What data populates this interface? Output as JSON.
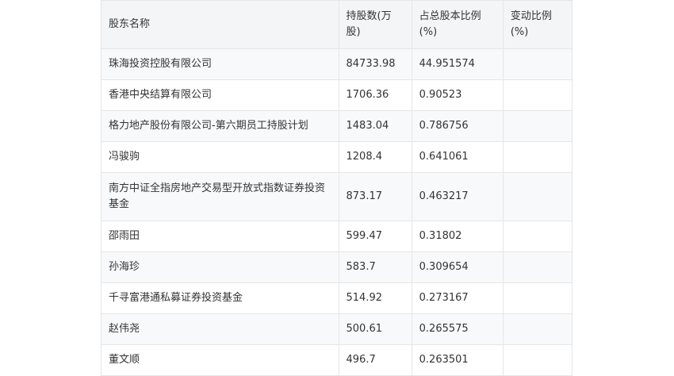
{
  "table": {
    "headers": [
      "股东名称",
      "持股数(万股)",
      "占总股本比例(%)",
      "变动比例(%)"
    ],
    "rows": [
      {
        "name": "珠海投资控股有限公司",
        "shares": "84733.98",
        "ratio": "44.951574",
        "change": ""
      },
      {
        "name": "香港中央结算有限公司",
        "shares": "1706.36",
        "ratio": "0.90523",
        "change": ""
      },
      {
        "name": "格力地产股份有限公司-第六期员工持股计划",
        "shares": "1483.04",
        "ratio": "0.786756",
        "change": ""
      },
      {
        "name": "冯骏驹",
        "shares": "1208.4",
        "ratio": "0.641061",
        "change": ""
      },
      {
        "name": "南方中证全指房地产交易型开放式指数证券投资基金",
        "shares": "873.17",
        "ratio": "0.463217",
        "change": ""
      },
      {
        "name": "邵雨田",
        "shares": "599.47",
        "ratio": "0.31802",
        "change": ""
      },
      {
        "name": "孙海珍",
        "shares": "583.7",
        "ratio": "0.309654",
        "change": ""
      },
      {
        "name": "千寻富港通私募证券投资基金",
        "shares": "514.92",
        "ratio": "0.273167",
        "change": ""
      },
      {
        "name": "赵伟尧",
        "shares": "500.61",
        "ratio": "0.265575",
        "change": ""
      },
      {
        "name": "董文顺",
        "shares": "496.7",
        "ratio": "0.263501",
        "change": ""
      }
    ]
  }
}
